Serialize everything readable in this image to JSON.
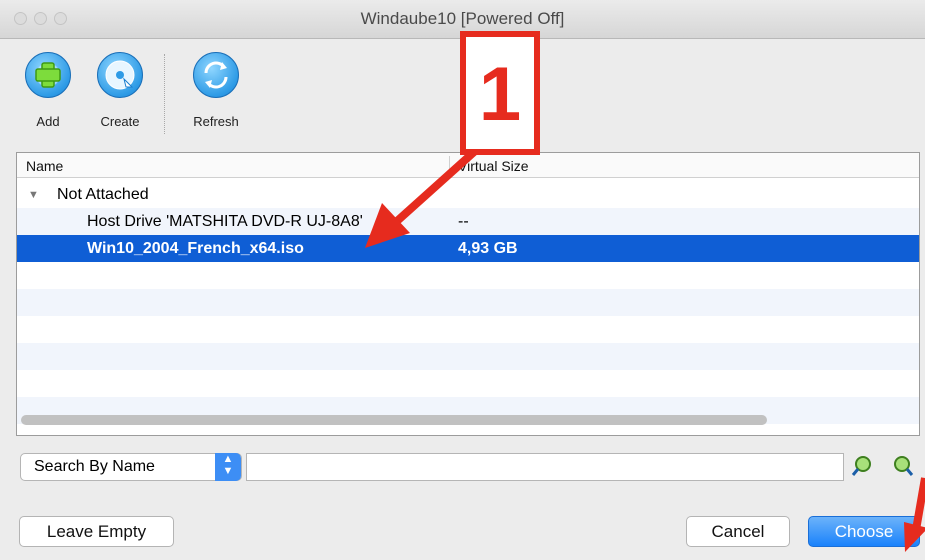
{
  "window": {
    "title": "Windaube10 [Powered Off]"
  },
  "toolbar": {
    "add_label": "Add",
    "create_label": "Create",
    "refresh_label": "Refresh"
  },
  "table": {
    "headers": [
      "Name",
      "Virtual Size"
    ],
    "group_label": "Not Attached",
    "rows": [
      {
        "name": "Host Drive 'MATSHITA DVD-R   UJ-8A8'",
        "size": "--"
      },
      {
        "name": "Win10_2004_French_x64.iso",
        "size": "4,93 GB"
      }
    ]
  },
  "search": {
    "mode": "Search By Name",
    "value": ""
  },
  "buttons": {
    "leave_empty": "Leave Empty",
    "cancel": "Cancel",
    "choose": "Choose"
  },
  "annotation": {
    "number": "1"
  },
  "colors": {
    "selection": "#0f5ed5",
    "annotation": "#e62b1e",
    "accent": "#1a82fb"
  }
}
